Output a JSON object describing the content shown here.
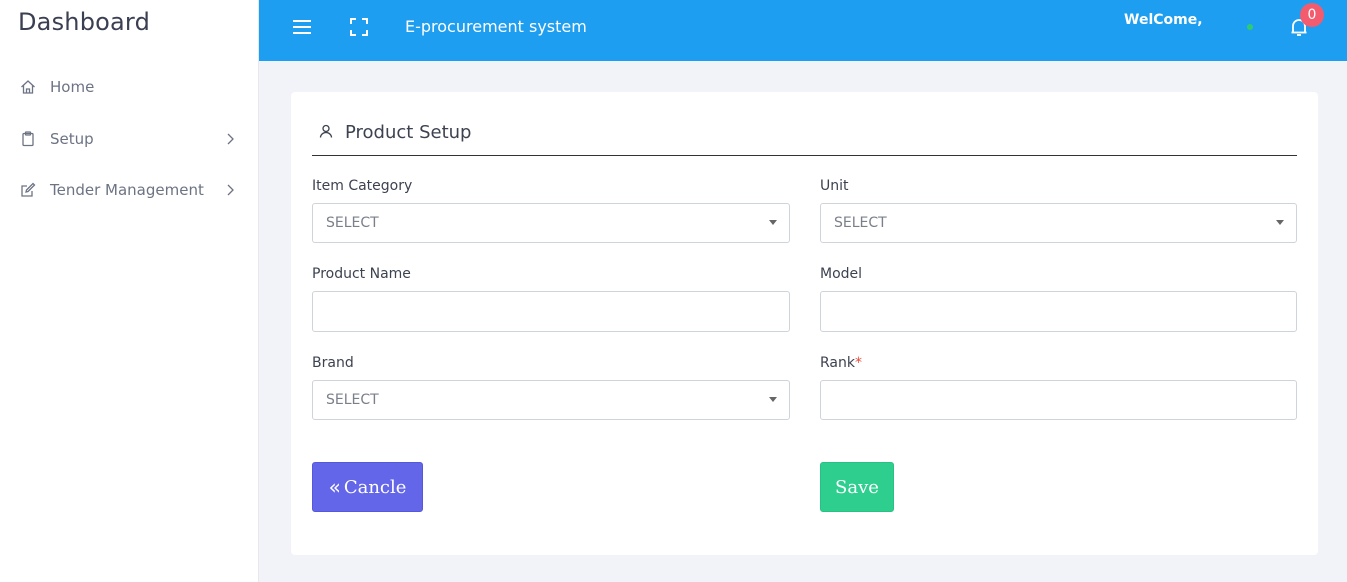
{
  "sidebar": {
    "brand": "Dashboard",
    "items": [
      {
        "label": "Home",
        "icon": "home-icon"
      },
      {
        "label": "Setup",
        "icon": "clipboard-icon"
      },
      {
        "label": "Tender Management",
        "icon": "edit-icon"
      }
    ]
  },
  "topbar": {
    "system_title": "E-procurement system",
    "welcome": "WelCome,",
    "notification_count": "0",
    "accent_color": "#1e9ef0"
  },
  "form": {
    "title": "Product Setup",
    "fields": {
      "item_category": {
        "label": "Item Category",
        "value": "SELECT"
      },
      "unit": {
        "label": "Unit",
        "value": "SELECT"
      },
      "product_name": {
        "label": "Product Name",
        "value": ""
      },
      "model": {
        "label": "Model",
        "value": ""
      },
      "brand": {
        "label": "Brand",
        "value": "SELECT"
      },
      "rank": {
        "label": "Rank",
        "required_mark": "*",
        "value": ""
      }
    },
    "buttons": {
      "cancel": "Cancle",
      "save": "Save"
    }
  }
}
